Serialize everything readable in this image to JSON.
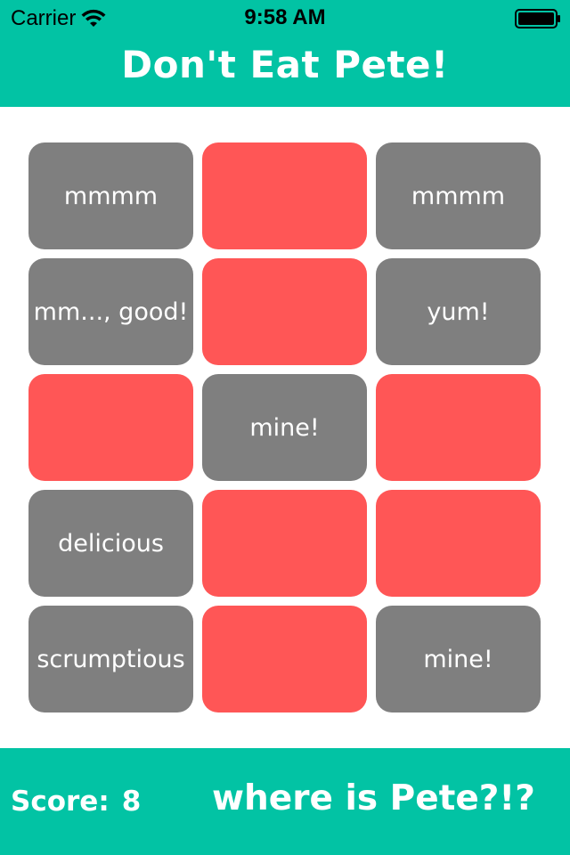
{
  "status_bar": {
    "carrier": "Carrier",
    "time": "9:58 AM",
    "wifi_icon": "wifi-icon",
    "battery_icon": "battery-icon"
  },
  "header": {
    "title": "Don't Eat Pete!"
  },
  "colors": {
    "brand": "#02c3a4",
    "tile_gray": "#7f7f7f",
    "tile_red": "#ff5656"
  },
  "tiles": [
    {
      "label": "mmmm",
      "color": "gray"
    },
    {
      "label": "",
      "color": "red"
    },
    {
      "label": "mmmm",
      "color": "gray"
    },
    {
      "label": "mm..., good!",
      "color": "gray"
    },
    {
      "label": "",
      "color": "red"
    },
    {
      "label": "yum!",
      "color": "gray"
    },
    {
      "label": "",
      "color": "red"
    },
    {
      "label": "mine!",
      "color": "gray"
    },
    {
      "label": "",
      "color": "red"
    },
    {
      "label": "delicious",
      "color": "gray"
    },
    {
      "label": "",
      "color": "red"
    },
    {
      "label": "",
      "color": "red"
    },
    {
      "label": "scrumptious",
      "color": "gray"
    },
    {
      "label": "",
      "color": "red"
    },
    {
      "label": "mine!",
      "color": "gray"
    }
  ],
  "footer": {
    "score_label": "Score:",
    "score_value": "8",
    "message": "where is Pete?!?"
  }
}
